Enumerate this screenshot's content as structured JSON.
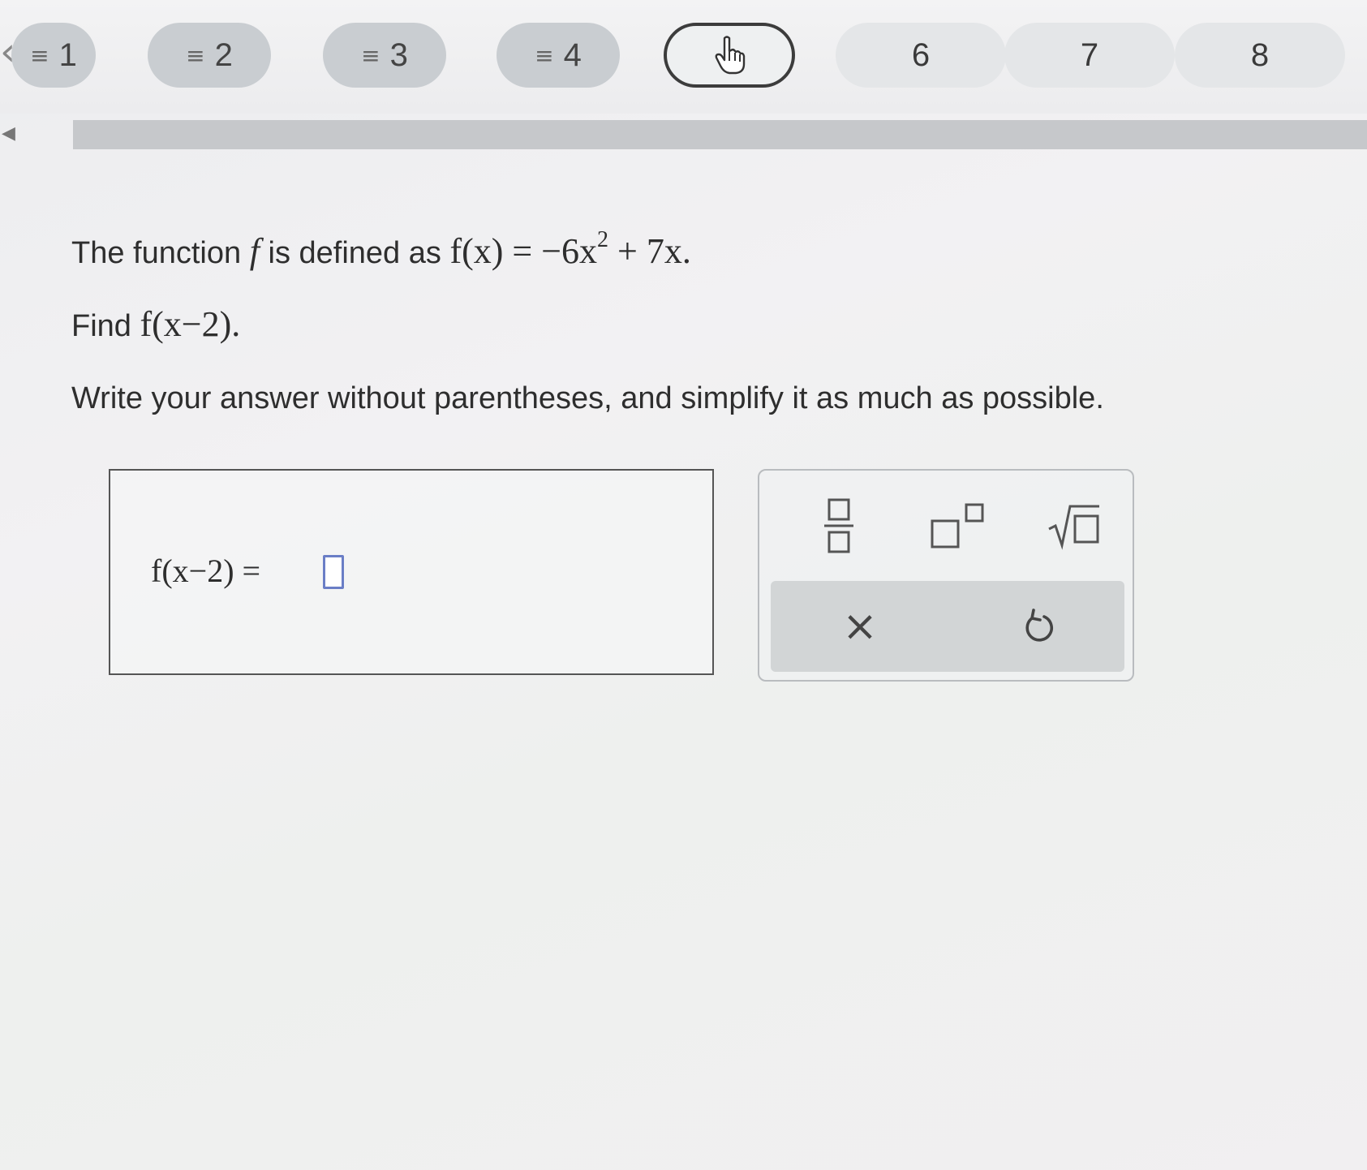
{
  "nav": {
    "questions": [
      {
        "number": "1",
        "status": "answered"
      },
      {
        "number": "2",
        "status": "answered"
      },
      {
        "number": "3",
        "status": "answered"
      },
      {
        "number": "4",
        "status": "answered"
      },
      {
        "number": "",
        "status": "current"
      },
      {
        "number": "6",
        "status": "unanswered"
      },
      {
        "number": "7",
        "status": "unanswered"
      },
      {
        "number": "8",
        "status": "unanswered"
      }
    ],
    "check_glyph": "≡"
  },
  "problem": {
    "intro_prefix": "The function",
    "fn_name": "f",
    "intro_mid": "is defined as",
    "definition_lhs": "f(x) = −6x",
    "definition_exp": "2",
    "definition_rhs": " + 7x.",
    "find_prefix": "Find",
    "find_expr": "f(x−2).",
    "instruction": "Write your answer without parentheses, and simplify it as much as possible."
  },
  "answer": {
    "lhs": "f(x−2) ="
  },
  "toolbar": {
    "fraction_icon": "fraction-icon",
    "exponent_icon": "exponent-icon",
    "sqrt_icon": "square-root-icon",
    "clear_icon": "clear-icon",
    "undo_icon": "undo-icon",
    "clear_glyph": "×"
  }
}
